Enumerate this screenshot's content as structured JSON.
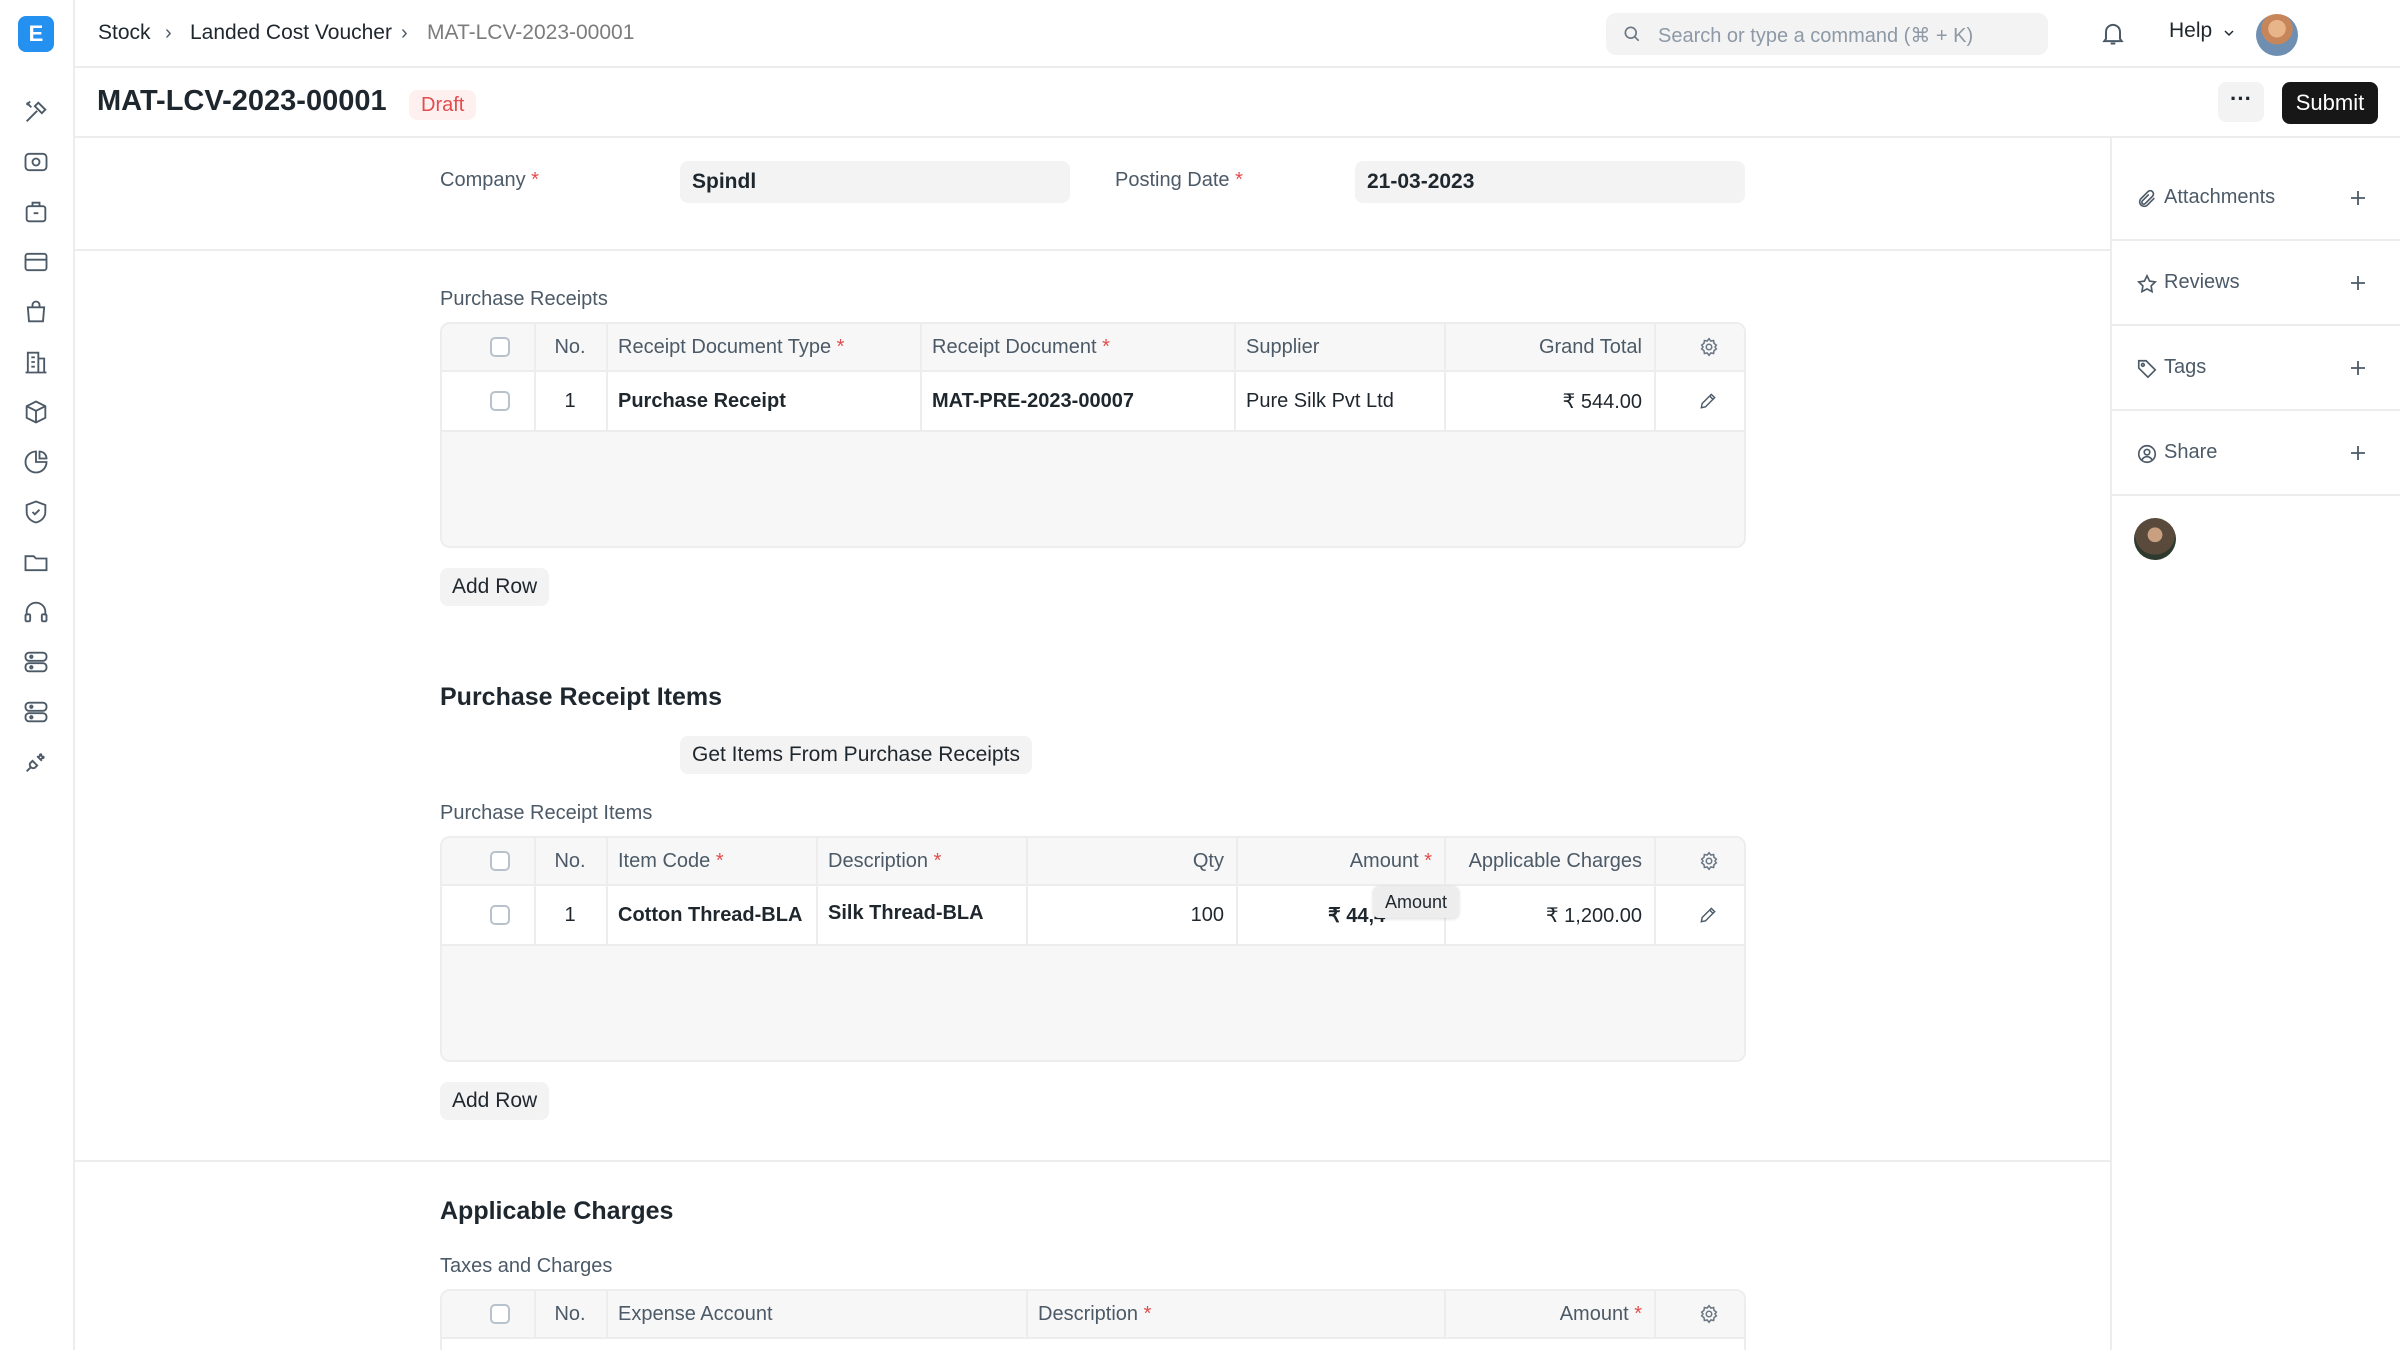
{
  "app": {
    "logo_letter": "E"
  },
  "breadcrumbs": [
    "Stock",
    "Landed Cost Voucher",
    "MAT-LCV-2023-00001"
  ],
  "search": {
    "placeholder": "Search or type a command (⌘ + K)"
  },
  "header": {
    "help_label": "Help"
  },
  "page": {
    "title": "MAT-LCV-2023-00001",
    "status": "Draft",
    "more_label": "···",
    "submit_label": "Submit"
  },
  "form": {
    "company": {
      "label": "Company",
      "value": "Spindl"
    },
    "posting_date": {
      "label": "Posting Date",
      "value": "21-03-2023"
    }
  },
  "purchase_receipts": {
    "label": "Purchase Receipts",
    "columns": [
      "No.",
      "Receipt Document Type",
      "Receipt Document",
      "Supplier",
      "Grand Total"
    ],
    "rows": [
      {
        "no": "1",
        "receipt_document_type": "Purchase Receipt",
        "receipt_document": "MAT-PRE-2023-00007",
        "supplier": "Pure Silk Pvt Ltd",
        "grand_total": "₹ 544.00"
      }
    ],
    "add_row_label": "Add Row"
  },
  "items_section": {
    "title": "Purchase Receipt Items",
    "get_items_label": "Get Items From Purchase Receipts",
    "table_label": "Purchase Receipt Items",
    "columns": [
      "No.",
      "Item Code",
      "Description",
      "Qty",
      "Amount",
      "Applicable Charges"
    ],
    "rows": [
      {
        "no": "1",
        "item_code": "Cotton Thread-BLA",
        "description": "Silk Thread-BLA",
        "qty": "100",
        "amount": "₹ 44,4",
        "applicable_charges": "₹ 1,200.00"
      }
    ],
    "tooltip": "Amount",
    "add_row_label": "Add Row"
  },
  "charges_section": {
    "title": "Applicable Charges",
    "table_label": "Taxes and Charges",
    "columns": [
      "No.",
      "Expense Account",
      "Description",
      "Amount"
    ]
  },
  "sidebar": {
    "items": [
      {
        "label": "Attachments",
        "icon": "paperclip-icon"
      },
      {
        "label": "Reviews",
        "icon": "star-icon"
      },
      {
        "label": "Tags",
        "icon": "tag-icon"
      },
      {
        "label": "Share",
        "icon": "share-icon"
      }
    ]
  },
  "colors": {
    "accent": "#2490ef",
    "required": "#e24c4c",
    "draft_badge_bg": "#fff0f0",
    "primary_button": "#171717"
  }
}
